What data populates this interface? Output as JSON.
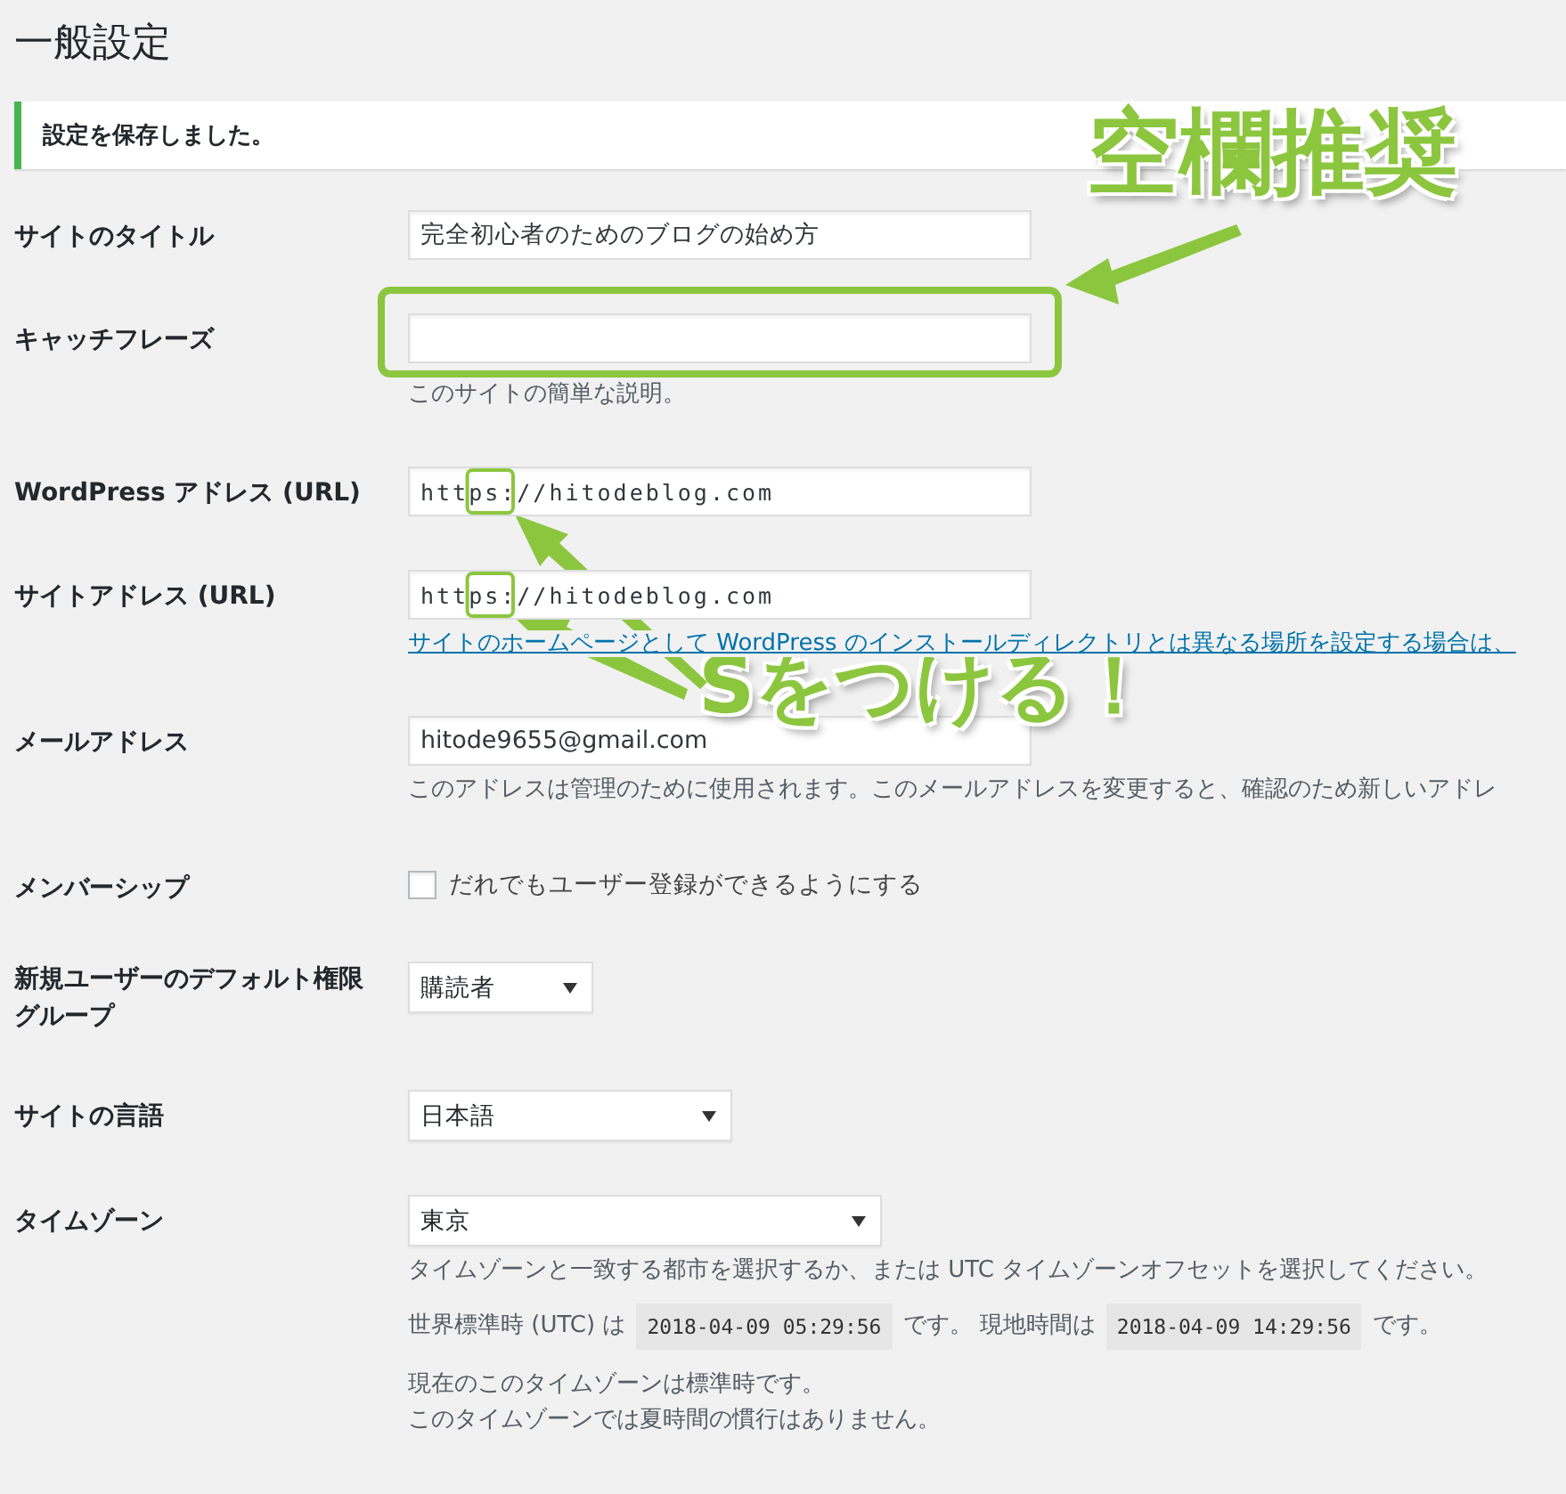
{
  "page_title": "一般設定",
  "notice": "設定を保存しました。",
  "fields": [
    {
      "kind": "text",
      "label": "サイトのタイトル",
      "value": "完全初心者のためのブログの始め方"
    },
    {
      "kind": "text",
      "label": "キャッチフレーズ",
      "description": "このサイトの簡単な説明。"
    },
    {
      "kind": "url",
      "label": "WordPress アドレス (URL)",
      "value": "https://hitodeblog.com"
    },
    {
      "kind": "url",
      "label": "サイトアドレス (URL)",
      "value": "https://hitodeblog.com",
      "link": "サイトのホームページとして WordPress のインストールディレクトリとは異なる場所を設定する場合は、"
    },
    {
      "kind": "text",
      "label": "メールアドレス",
      "value": "hitode9655@gmail.com",
      "description": "このアドレスは管理のために使用されます。このメールアドレスを変更すると、確認のため新しいアドレ"
    },
    {
      "kind": "checkbox",
      "label": "メンバーシップ",
      "option": "だれでもユーザー登録ができるようにする",
      "checked": false
    },
    {
      "kind": "select",
      "label": "新規ユーザーのデフォルト権限グループ",
      "value": "購読者"
    },
    {
      "kind": "select",
      "label": "サイトの言語",
      "value": "日本語"
    },
    {
      "kind": "timezone",
      "label": "タイムゾーン",
      "value": "東京",
      "description": "タイムゾーンと一致する都市を選択するか、または UTC タイムゾーンオフセットを選択してください。",
      "times": [
        {
          "kind": "text",
          "text": "世界標準時 (UTC) は"
        },
        {
          "kind": "code",
          "text": "2018-04-09 05:29:56"
        },
        {
          "kind": "text",
          "text": "です。 現地時間は"
        },
        {
          "kind": "code",
          "text": "2018-04-09 14:29:56"
        },
        {
          "kind": "text",
          "text": "です。"
        }
      ],
      "notes": [
        "現在のこのタイムゾーンは標準時です。",
        "このタイムゾーンでは夏時間の慣行はありません。"
      ]
    }
  ],
  "annotations": [
    {
      "kind": "callout",
      "text": "空欄推奨"
    },
    {
      "kind": "callout",
      "text": "Sをつける！"
    }
  ]
}
